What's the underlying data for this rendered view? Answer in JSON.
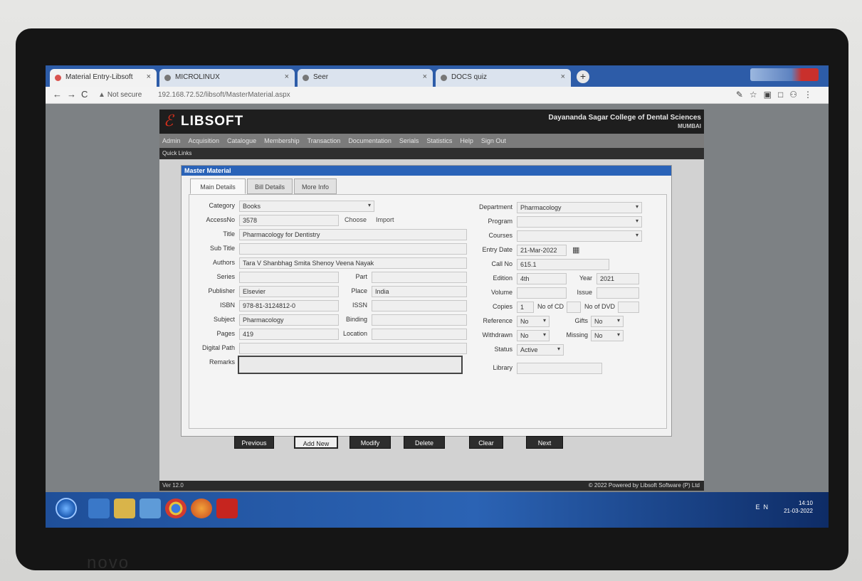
{
  "monitor_brand": "novo",
  "browser": {
    "tabs": [
      {
        "label": "Material Entry-Libsoft",
        "active": true
      },
      {
        "label": "MICROLINUX",
        "active": false
      },
      {
        "label": "Seer",
        "active": false
      },
      {
        "label": "DOCS quiz",
        "active": false
      }
    ],
    "address_security": "Not secure",
    "address_url": "192.168.72.52/libsoft/MasterMaterial.aspx"
  },
  "app": {
    "logo_mark": "ℰ",
    "logo_text": "LIBSOFT",
    "college_name": "Dayananda Sagar College of Dental Sciences",
    "college_city": "MUMBAI",
    "menu": [
      "Admin",
      "Acquisition",
      "Catalogue",
      "Membership",
      "Transaction",
      "Documentation",
      "Serials",
      "Statistics",
      "Help",
      "Sign Out"
    ],
    "quick_links": "Quick Links",
    "panel_title": "Master Material",
    "tabs": [
      "Main Details",
      "Bill Details",
      "More Info"
    ],
    "left": {
      "category": {
        "label": "Category",
        "value": "Books"
      },
      "accession": {
        "label": "AccessNo",
        "value": "3578",
        "choose": "Choose",
        "import": "Import"
      },
      "title": {
        "label": "Title",
        "value": "Pharmacology for Dentistry"
      },
      "subtitle": {
        "label": "Sub Title",
        "value": ""
      },
      "authors": {
        "label": "Authors",
        "value": "Tara V Shanbhag Smita Shenoy Veena Nayak"
      },
      "series": {
        "label": "Series",
        "value": ""
      },
      "part": {
        "label": "Part",
        "value": ""
      },
      "publisher": {
        "label": "Publisher",
        "value": "Elsevier"
      },
      "place": {
        "label": "Place",
        "value": "India"
      },
      "isbn": {
        "label": "ISBN",
        "value": "978-81-3124812-0"
      },
      "issn": {
        "label": "ISSN",
        "value": ""
      },
      "subject": {
        "label": "Subject",
        "value": "Pharmacology"
      },
      "binding": {
        "label": "Binding",
        "value": ""
      },
      "pages": {
        "label": "Pages",
        "value": "419"
      },
      "location": {
        "label": "Location",
        "value": ""
      },
      "digital_path": {
        "label": "Digital Path",
        "value": ""
      },
      "remarks": {
        "label": "Remarks",
        "value": ""
      }
    },
    "right": {
      "department": {
        "label": "Department",
        "value": "Pharmacology"
      },
      "program": {
        "label": "Program",
        "value": ""
      },
      "courses": {
        "label": "Courses",
        "value": ""
      },
      "entry_date": {
        "label": "Entry Date",
        "value": "21-Mar-2022"
      },
      "call_no": {
        "label": "Call No",
        "value": "615.1"
      },
      "edition": {
        "label": "Edition",
        "value": "4th"
      },
      "year": {
        "label": "Year",
        "value": "2021"
      },
      "volume": {
        "label": "Volume",
        "value": ""
      },
      "issue": {
        "label": "Issue",
        "value": ""
      },
      "copies": {
        "label": "Copies",
        "value": "1"
      },
      "no_cd": {
        "label": "No of CD",
        "value": ""
      },
      "no_dvd": {
        "label": "No of DVD",
        "value": ""
      },
      "reference": {
        "label": "Reference",
        "value": "No"
      },
      "gifts": {
        "label": "Gifts",
        "value": "No"
      },
      "withdrawn": {
        "label": "Withdrawn",
        "value": "No"
      },
      "missing": {
        "label": "Missing",
        "value": "No"
      },
      "status": {
        "label": "Status",
        "value": "Active"
      },
      "library": {
        "label": "Library",
        "value": ""
      }
    },
    "buttons": {
      "previous": "Previous",
      "add_new": "Add New",
      "modify": "Modify",
      "delete": "Delete",
      "clear": "Clear",
      "next": "Next"
    },
    "version": "Ver 12.0",
    "footer": "© 2022 Powered by Libsoft Software (P) Ltd"
  },
  "taskbar": {
    "time": "14:10",
    "date": "21-03-2022",
    "tray": "EN"
  }
}
